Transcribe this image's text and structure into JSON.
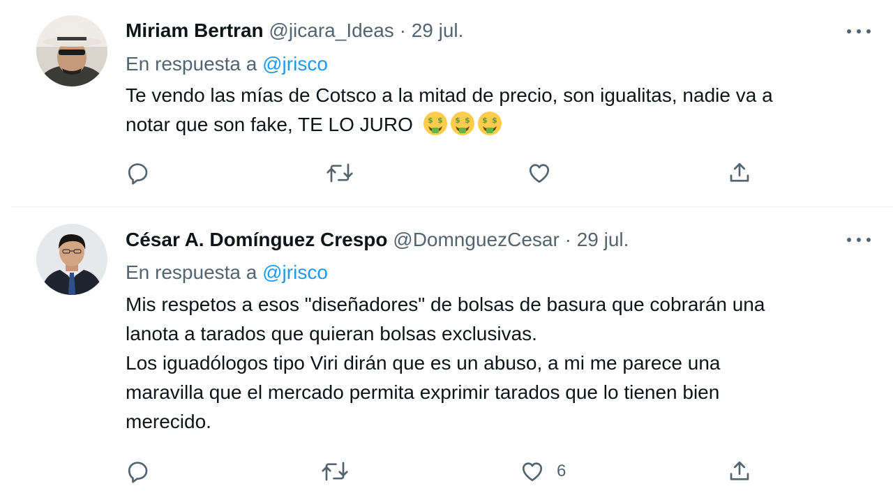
{
  "colors": {
    "text": "#0f1419",
    "secondary": "#536471",
    "link": "#1d9bf0",
    "divider": "#eff3f4"
  },
  "tweets": [
    {
      "author_name": "Miriam Bertran",
      "author_handle": "@jicara_Ideas",
      "separator": "·",
      "date": "29 jul.",
      "reply_prefix": "En respuesta a",
      "reply_to": "@jrisco",
      "text_lines": [
        "Te vendo las mías de Cotsco a la mitad de precio, son igualitas, nadie va a",
        "notar que son fake, TE LO JURO"
      ],
      "emojis": [
        "money-mouth-face",
        "money-mouth-face",
        "money-mouth-face"
      ],
      "avatar": "avatar-man-white-hat-sunglasses",
      "actions": {
        "reply_icon": "reply-icon",
        "retweet_icon": "retweet-icon",
        "like_icon": "heart-icon",
        "share_icon": "share-icon",
        "like_count": ""
      }
    },
    {
      "author_name": "César A. Domínguez Crespo",
      "author_handle": "@DomnguezCesar",
      "separator": "·",
      "date": "29 jul.",
      "reply_prefix": "En respuesta a",
      "reply_to": "@jrisco",
      "text_lines": [
        "Mis respetos a esos \"diseñadores\" de bolsas de basura que cobrarán una",
        "lanota a tarados que quieran bolsas exclusivas.",
        "Los iguadólogos tipo Viri dirán que es un abuso, a mi me parece una",
        "maravilla que el mercado permita exprimir tarados que lo tienen bien",
        "merecido."
      ],
      "avatar": "avatar-man-suit-tie",
      "actions": {
        "reply_icon": "reply-icon",
        "retweet_icon": "retweet-icon",
        "like_icon": "heart-icon",
        "share_icon": "share-icon",
        "like_count": "6"
      }
    }
  ]
}
